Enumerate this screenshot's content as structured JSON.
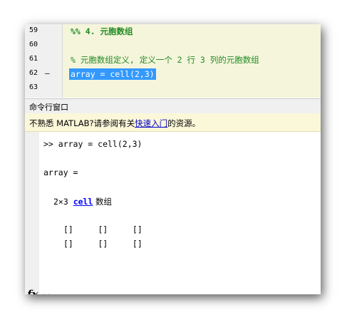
{
  "editor": {
    "lines": [
      {
        "num": "59",
        "dash": "",
        "text": "%% 4. 元胞数组",
        "kind": "cell-title"
      },
      {
        "num": "60",
        "dash": "",
        "text": "",
        "kind": "plain"
      },
      {
        "num": "61",
        "dash": "",
        "text": "% 元胞数组定义, 定义一个 2 行 3 列的元胞数组",
        "kind": "comment"
      },
      {
        "num": "62",
        "dash": "–",
        "text": "array = cell(2,3)",
        "kind": "sel"
      },
      {
        "num": "63",
        "dash": "",
        "text": "",
        "kind": "plain"
      }
    ]
  },
  "command_window": {
    "title": "命令行窗口",
    "banner": {
      "prefix": "不熟悉 MATLAB?请参阅有关",
      "link": "快速入门",
      "suffix": "的资源。"
    },
    "output": {
      "cmd": ">> array = cell(2,3)",
      "assign": "array =",
      "size_prefix": "2×3 ",
      "size_link": "cell",
      "size_suffix": " 数组",
      "row1": "[]     []     []",
      "row2": "[]     []     []",
      "prompt": ">>"
    },
    "fx_icon": "fx"
  },
  "colors": {
    "editor_bg": "#f5f5dc",
    "comment": "#228b22",
    "selection": "#3399ff",
    "link": "#0000ff",
    "banner_bg": "#fbf7d9"
  }
}
